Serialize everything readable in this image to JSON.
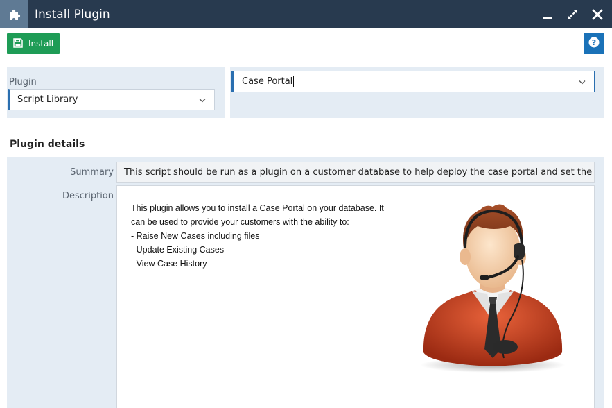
{
  "window": {
    "title": "Install Plugin",
    "icon": "puzzle-icon",
    "controls": [
      "minimize-icon",
      "maximize-icon",
      "close-icon"
    ]
  },
  "toolbar": {
    "install_label": "Install",
    "install_icon": "save-icon",
    "help_icon": "help-icon"
  },
  "plugin": {
    "label": "Plugin",
    "source_value": "Script Library",
    "plugin_value": "Case Portal"
  },
  "details": {
    "title": "Plugin details",
    "summary_label": "Summary",
    "summary_value": "This script should be run as a plugin on a customer database to help deploy the case portal and set the parame",
    "description_label": "Description",
    "description_lines": [
      "This plugin allows you to install a Case Portal on your database. It",
      "can be used to provide your customers with the ability to:",
      "- Raise New Cases including files",
      "- Update Existing Cases",
      "- View Case History"
    ]
  },
  "colors": {
    "titlebar": "#283a4f",
    "title_icon_bg": "#5f7a94",
    "install_button": "#1e9c56",
    "help_button": "#1a72b8",
    "panel_bg": "#e4ecf4",
    "accent": "#2a6fb0"
  }
}
